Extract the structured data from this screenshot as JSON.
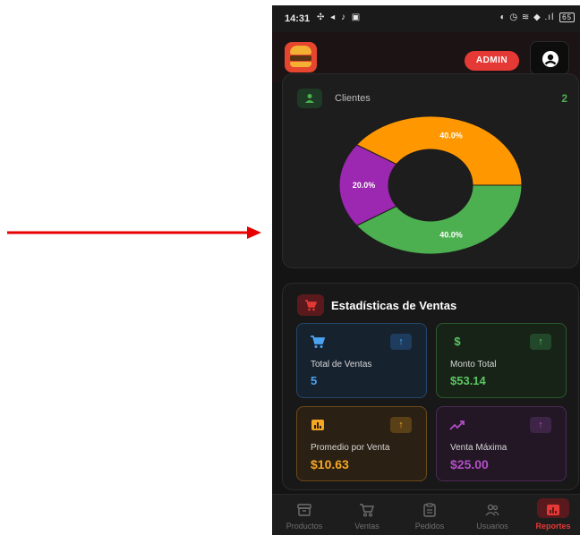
{
  "status_bar": {
    "time": "14:31",
    "left_icons": "✣ ◂ ♪ ▣",
    "right_icons": "◐ ◷ ≋ ◆ .ıl",
    "battery": "65"
  },
  "app_bar": {
    "role_badge": "ADMIN",
    "logo_icon": "burger-logo",
    "profile_icon": "user-circle-icon"
  },
  "clients_card": {
    "label": "Clientes",
    "count": "2"
  },
  "chart_data": {
    "type": "pie",
    "subtype": "donut",
    "slices": [
      {
        "label": "40.0%",
        "value": 40.0,
        "color": "#4caf50"
      },
      {
        "label": "20.0%",
        "value": 20.0,
        "color": "#9c27b0"
      },
      {
        "label": "40.0%",
        "value": 40.0,
        "color": "#ff9800"
      }
    ],
    "start_angle_deg": 0,
    "direction": "clockwise-from-right"
  },
  "sales": {
    "title": "Estadísticas de Ventas",
    "stats": [
      {
        "label": "Total de Ventas",
        "value": "5",
        "icon": "cart-icon",
        "trend_icon": "arrow-up-icon",
        "color": "#4aa3f0"
      },
      {
        "label": "Monto Total",
        "value": "$53.14",
        "icon": "dollar-icon",
        "trend_icon": "arrow-up-icon",
        "color": "#5cc763"
      },
      {
        "label": "Promedio por Venta",
        "value": "$10.63",
        "icon": "bar-chart-icon",
        "trend_icon": "arrow-up-icon",
        "color": "#f5a623"
      },
      {
        "label": "Venta Máxima",
        "value": "$25.00",
        "icon": "trending-up-icon",
        "trend_icon": "arrow-up-icon",
        "color": "#b14fc4"
      }
    ]
  },
  "bottom_nav": {
    "items": [
      {
        "label": "Productos",
        "icon": "archive-icon",
        "active": false
      },
      {
        "label": "Ventas",
        "icon": "cart-icon",
        "active": false
      },
      {
        "label": "Pedidos",
        "icon": "clipboard-icon",
        "active": false
      },
      {
        "label": "Usuarios",
        "icon": "users-icon",
        "active": false
      },
      {
        "label": "Reportes",
        "icon": "report-icon",
        "active": true
      }
    ]
  },
  "colors": {
    "accent": "#e53935",
    "background": "#141414",
    "arrow": "#e60000"
  }
}
